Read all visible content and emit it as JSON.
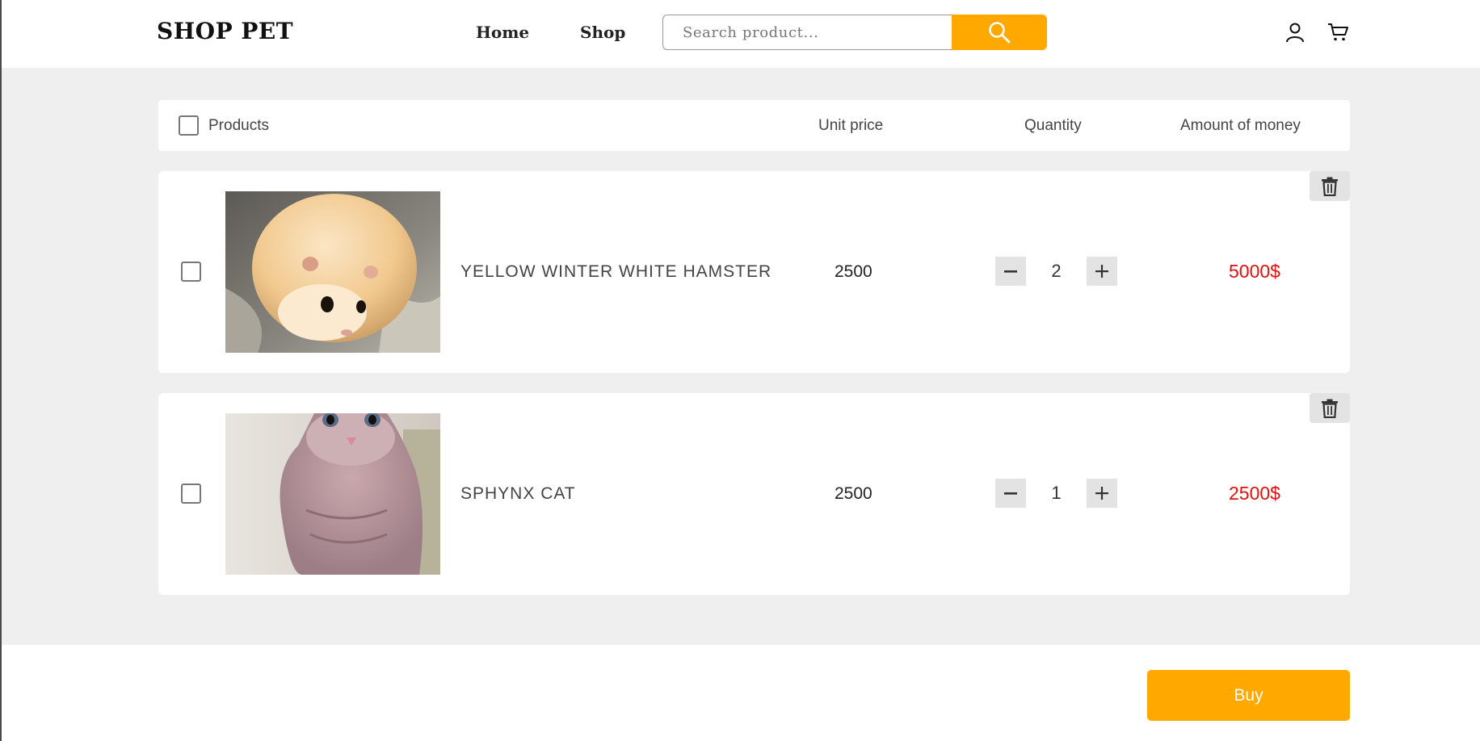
{
  "header": {
    "logo": "SHOP PET",
    "nav": [
      {
        "label": "Home"
      },
      {
        "label": "Shop"
      }
    ],
    "search": {
      "placeholder": "Search product...",
      "value": ""
    },
    "icons": [
      "search-icon",
      "user-icon",
      "cart-icon"
    ]
  },
  "table": {
    "headers": {
      "products": "Products",
      "unit_price": "Unit price",
      "quantity": "Quantity",
      "amount": "Amount of money"
    }
  },
  "items": [
    {
      "name": "YELLOW WINTER WHITE HAMSTER",
      "price": "2500",
      "quantity": "2",
      "amount": "5000$",
      "image": "hamster-photo"
    },
    {
      "name": "SPHYNX CAT",
      "price": "2500",
      "quantity": "1",
      "amount": "2500$",
      "image": "sphynx-cat-photo"
    }
  ],
  "footer": {
    "buy_label": "Buy"
  },
  "colors": {
    "accent": "#ffa800",
    "price": "#e01010",
    "background": "#efefef"
  }
}
